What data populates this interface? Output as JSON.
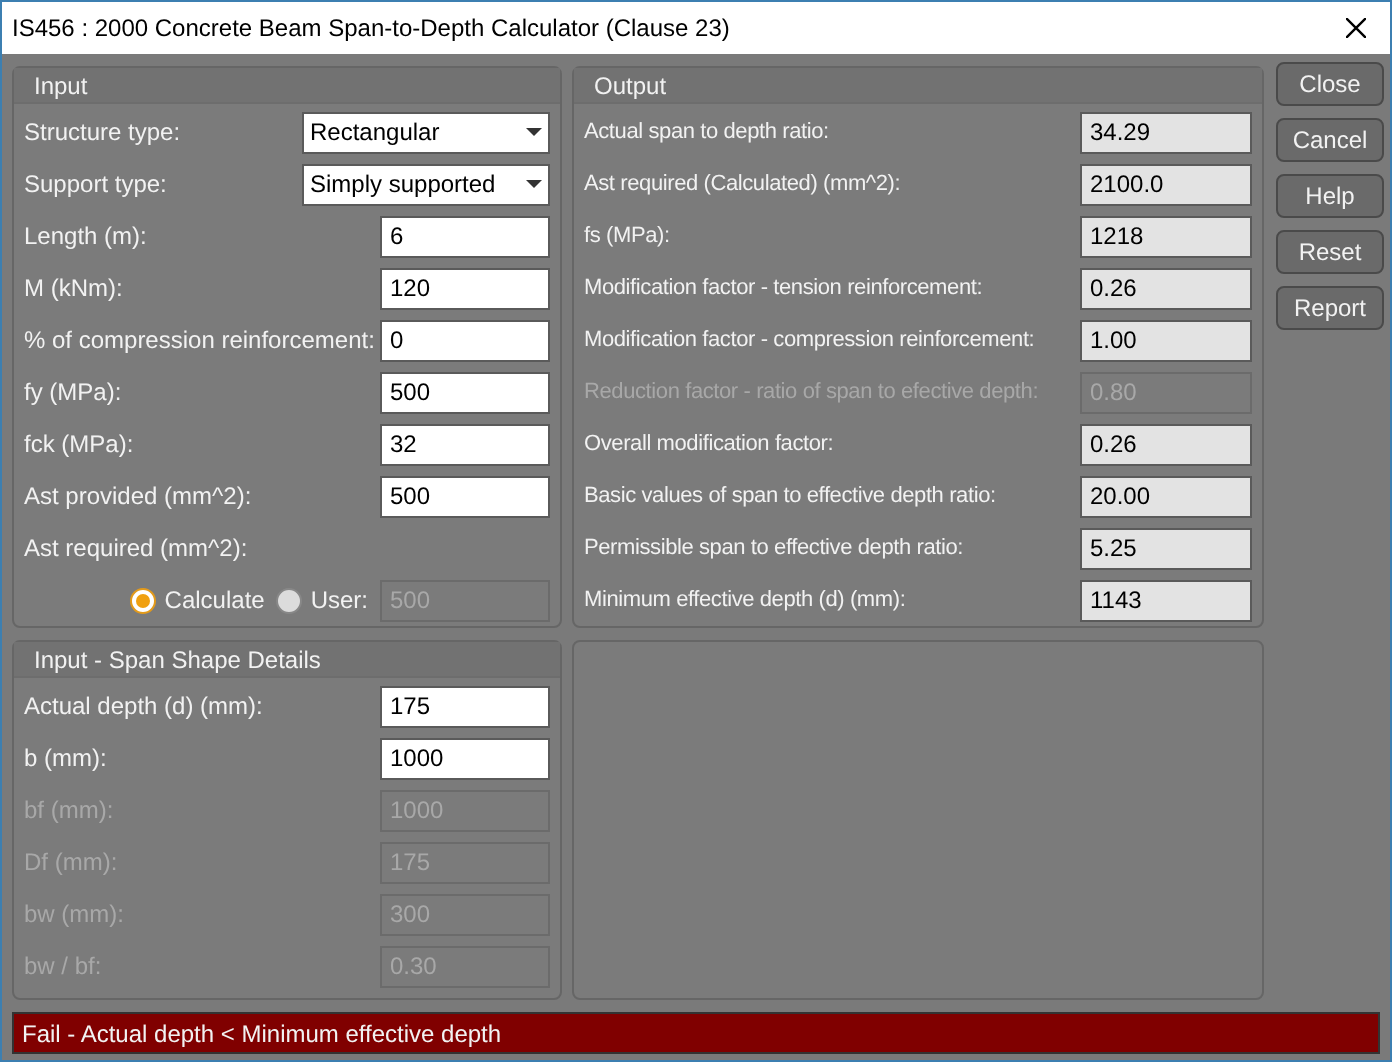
{
  "window": {
    "title": "IS456 : 2000 Concrete Beam Span-to-Depth Calculator (Clause 23)"
  },
  "input": {
    "title": "Input",
    "rows": [
      {
        "kind": "select",
        "label": "Structure type:",
        "value": "Rectangular",
        "disabled": false
      },
      {
        "kind": "select",
        "label": "Support type:",
        "value": "Simply supported",
        "disabled": false
      },
      {
        "kind": "field",
        "label": "Length (m):",
        "value": "6",
        "disabled": false
      },
      {
        "kind": "field",
        "label": "M (kNm):",
        "value": "120",
        "disabled": false
      },
      {
        "kind": "field",
        "label": "% of compression reinforcement:",
        "value": "0",
        "disabled": false
      },
      {
        "kind": "field",
        "label": "fy (MPa):",
        "value": "500",
        "disabled": false
      },
      {
        "kind": "field",
        "label": "fck (MPa):",
        "value": "32",
        "disabled": false
      },
      {
        "kind": "field",
        "label": "Ast provided (mm^2):",
        "value": "500",
        "disabled": false
      },
      {
        "kind": "label",
        "label": "Ast required (mm^2):"
      }
    ],
    "ast_mode": {
      "options": [
        {
          "label": "Calculate",
          "selected": true
        },
        {
          "label": "User:",
          "selected": false
        }
      ],
      "user_value": "500",
      "user_disabled": true
    }
  },
  "span_shape": {
    "title": "Input - Span Shape Details",
    "rows": [
      {
        "label": "Actual depth (d) (mm):",
        "value": "175",
        "disabled": false
      },
      {
        "label": "b (mm):",
        "value": "1000",
        "disabled": false
      },
      {
        "label": "bf (mm):",
        "value": "1000",
        "disabled": true
      },
      {
        "label": "Df (mm):",
        "value": "175",
        "disabled": true
      },
      {
        "label": "bw (mm):",
        "value": "300",
        "disabled": true
      },
      {
        "label": "bw / bf:",
        "value": "0.30",
        "disabled": true
      }
    ]
  },
  "output": {
    "title": "Output",
    "rows": [
      {
        "label": "Actual span to depth ratio:",
        "value": "34.29",
        "disabled": false
      },
      {
        "label": "Ast required (Calculated) (mm^2):",
        "value": "2100.0",
        "disabled": false
      },
      {
        "label": "fs (MPa):",
        "value": "1218",
        "disabled": false
      },
      {
        "label": "Modification factor - tension reinforcement:",
        "value": "0.26",
        "disabled": false
      },
      {
        "label": "Modification factor - compression reinforcement:",
        "value": "1.00",
        "disabled": false
      },
      {
        "label": "Reduction factor - ratio of span to efective depth:",
        "value": "0.80",
        "disabled": true
      },
      {
        "label": "Overall modification factor:",
        "value": "0.26",
        "disabled": false
      },
      {
        "label": "Basic values of span to effective depth ratio:",
        "value": "20.00",
        "disabled": false
      },
      {
        "label": "Permissible span to effective depth ratio:",
        "value": "5.25",
        "disabled": false
      },
      {
        "label": "Minimum effective depth (d) (mm):",
        "value": "1143",
        "disabled": false
      }
    ]
  },
  "buttons": [
    "Close",
    "Cancel",
    "Help",
    "Reset",
    "Report"
  ],
  "status_bar": {
    "text": "Fail - Actual depth < Minimum effective depth",
    "failed": true
  }
}
